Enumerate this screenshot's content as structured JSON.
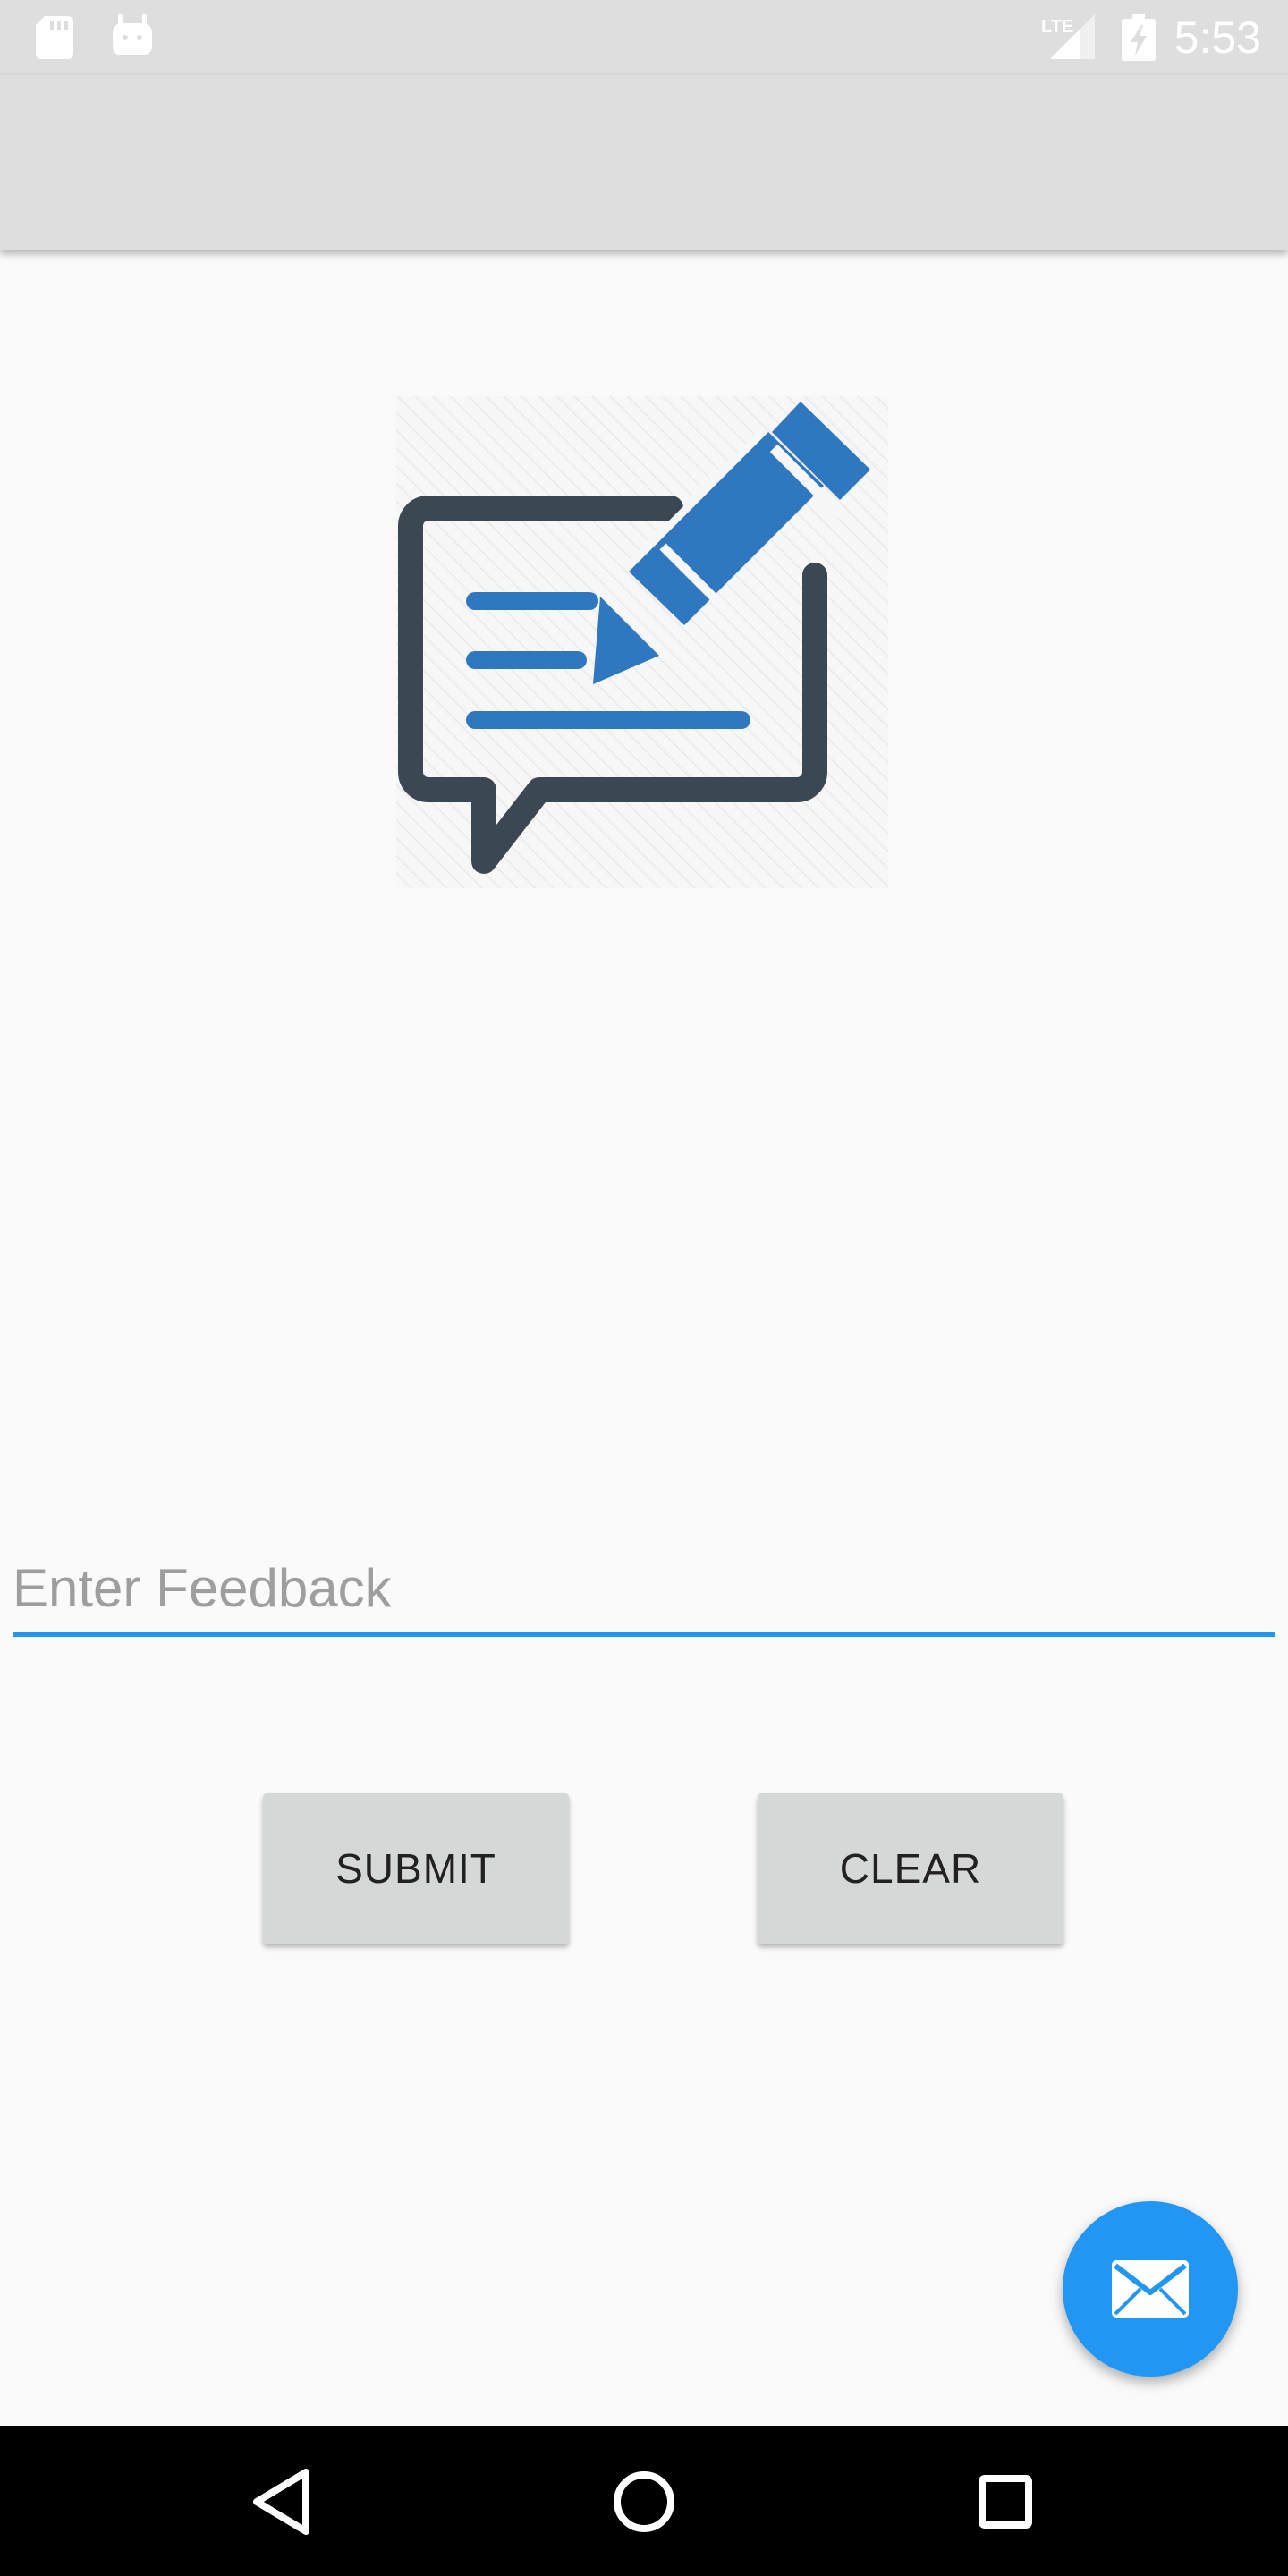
{
  "status_bar": {
    "time": "5:53",
    "network_label": "LTE",
    "icons": [
      "sd-card-icon",
      "android-debug-icon",
      "lte-signal-icon",
      "battery-charging-icon"
    ]
  },
  "hero": {
    "icon": "feedback-edit-icon"
  },
  "feedback": {
    "placeholder": "Enter Feedback",
    "value": ""
  },
  "buttons": {
    "submit_label": "SUBMIT",
    "clear_label": "CLEAR"
  },
  "fab": {
    "icon": "mail-icon"
  },
  "nav": {
    "icons": [
      "back-icon",
      "home-icon",
      "recents-icon"
    ]
  },
  "colors": {
    "accent": "#2196f3",
    "icon_blue": "#2f77bf",
    "icon_dark": "#3c4754",
    "bar_gray": "#dedede",
    "button_gray": "#d6d7d7"
  }
}
